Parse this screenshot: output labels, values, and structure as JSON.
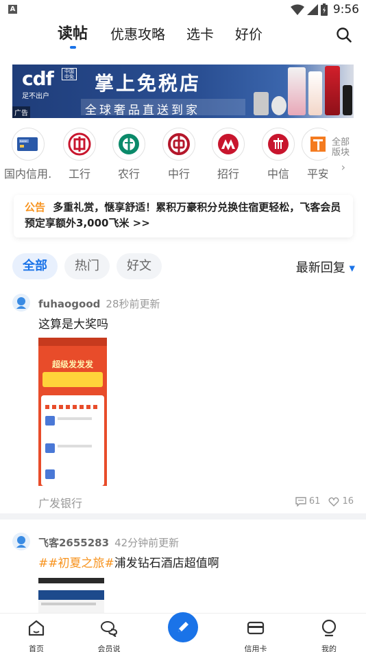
{
  "status_bar": {
    "time": "9:56",
    "notification_icon": "A"
  },
  "top_tabs": [
    {
      "label": "读帖",
      "active": true
    },
    {
      "label": "优惠攻略",
      "active": false
    },
    {
      "label": "选卡",
      "active": false
    },
    {
      "label": "好价",
      "active": false
    }
  ],
  "banner": {
    "logo": "cdf",
    "logo_badge": "中国中免",
    "logo_sub": "足不出户",
    "title": "掌上免税店",
    "slogan": "全球奢品直送到家",
    "ad_label": "广告"
  },
  "banks": [
    {
      "label": "国内信用…",
      "icon": "bank-card-icon"
    },
    {
      "label": "工行",
      "icon": "icbc-logo-icon"
    },
    {
      "label": "农行",
      "icon": "abc-logo-icon"
    },
    {
      "label": "中行",
      "icon": "boc-logo-icon"
    },
    {
      "label": "招行",
      "icon": "cmb-logo-icon"
    },
    {
      "label": "中信",
      "icon": "citic-logo-icon"
    },
    {
      "label": "平安",
      "icon": "pingan-logo-icon"
    }
  ],
  "all_boards": {
    "line1": "全部",
    "line2": "版块",
    "arrow": "›"
  },
  "notice": {
    "tag": "公告",
    "text": "多重礼赏，惬享舒适！累积万豪积分兑换住宿更轻松，飞客会员预定享额外3,000飞米 >>"
  },
  "filters": {
    "chips": [
      {
        "label": "全部",
        "active": true
      },
      {
        "label": "热门",
        "active": false
      },
      {
        "label": "好文",
        "active": false
      }
    ],
    "sort_label": "最新回复",
    "sort_caret": "▼"
  },
  "posts": [
    {
      "user": "fuhaogood",
      "time": "28秒前更新",
      "text": "这算是大奖吗",
      "source": "广发银行",
      "comments": "61",
      "likes": "16",
      "image_text": "超级发发发"
    },
    {
      "user": "飞客2655283",
      "time": "42分钟前更新",
      "hashtag": "##初夏之旅#",
      "text": "浦发钻石酒店超值啊"
    }
  ],
  "bottom_nav": [
    {
      "label": "首页",
      "icon": "home-icon"
    },
    {
      "label": "会员说",
      "icon": "chat-icon"
    },
    {
      "label": "",
      "icon": "pencil-icon"
    },
    {
      "label": "信用卡",
      "icon": "credit-card-icon"
    },
    {
      "label": "我的",
      "icon": "profile-icon"
    }
  ],
  "colors": {
    "accent": "#1a73e8",
    "hashtag": "#f7931e"
  }
}
